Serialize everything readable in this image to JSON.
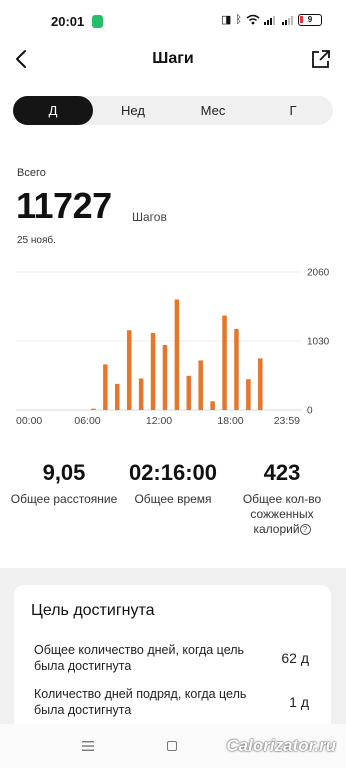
{
  "status_bar": {
    "time": "20:01",
    "battery": "9"
  },
  "header": {
    "title": "Шаги"
  },
  "tabs": [
    {
      "label": "Д",
      "active": true
    },
    {
      "label": "Нед",
      "active": false
    },
    {
      "label": "Мес",
      "active": false
    },
    {
      "label": "Г",
      "active": false
    }
  ],
  "summary": {
    "total_label": "Всего",
    "total_value": "11727",
    "unit": "Шагов",
    "date": "25 нояб."
  },
  "chart_data": {
    "type": "bar",
    "bar_color": "#e8752a",
    "x_ticks": [
      "00:00",
      "06:00",
      "12:00",
      "18:00",
      "23:59"
    ],
    "y_ticks": [
      "2060",
      "1030",
      "0"
    ],
    "ylim": [
      0,
      2060
    ],
    "x_range_hours": [
      0,
      24
    ],
    "bars": [
      {
        "hour": 6.0,
        "value": 20
      },
      {
        "hour": 7.0,
        "value": 680
      },
      {
        "hour": 8.0,
        "value": 390
      },
      {
        "hour": 9.0,
        "value": 1190
      },
      {
        "hour": 10.0,
        "value": 470
      },
      {
        "hour": 11.0,
        "value": 1150
      },
      {
        "hour": 12.0,
        "value": 970
      },
      {
        "hour": 13.0,
        "value": 1650
      },
      {
        "hour": 14.0,
        "value": 510
      },
      {
        "hour": 15.0,
        "value": 740
      },
      {
        "hour": 16.0,
        "value": 130
      },
      {
        "hour": 17.0,
        "value": 1410
      },
      {
        "hour": 18.0,
        "value": 1210
      },
      {
        "hour": 19.0,
        "value": 460
      },
      {
        "hour": 20.0,
        "value": 770
      }
    ]
  },
  "stats": {
    "distance_value": "9,05",
    "distance_label": "Общее расстояние",
    "time_value": "02:16:00",
    "time_label": "Общее время",
    "calories_value": "423",
    "calories_label_1": "Общее кол-во",
    "calories_label_2": "сожженных",
    "calories_label_3": "калорий",
    "info_glyph": "?"
  },
  "goal": {
    "title": "Цель достигнута",
    "row1_text": "Общее количество дней, когда цель была достигнута",
    "row1_value": "62 д",
    "row2_text": "Количество дней подряд, когда цель была достигнута",
    "row2_value": "1 д"
  },
  "watermark": "Calorizator.ru"
}
